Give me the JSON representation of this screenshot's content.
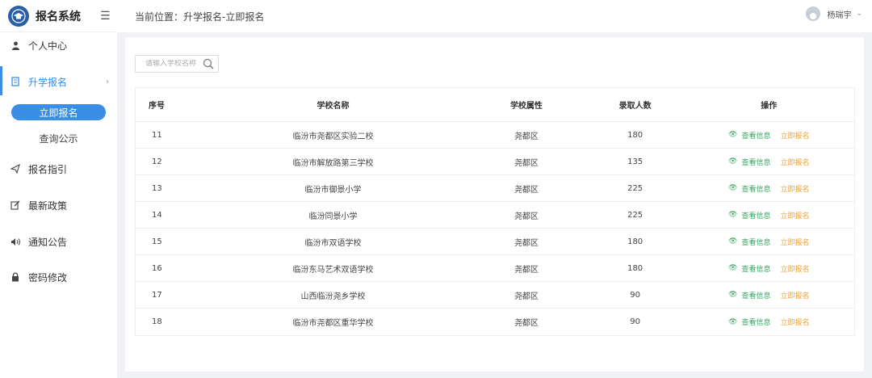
{
  "app": {
    "title": "报名系统",
    "logo_icon": "cap-logo-icon",
    "accent": "#3a8ee6"
  },
  "header": {
    "breadcrumb": "当前位置：升学报名-立即报名",
    "username": "杨瑞宇"
  },
  "sidebar": {
    "items": [
      {
        "label": "个人中心",
        "icon": "user-icon"
      },
      {
        "label": "升学报名",
        "icon": "document-icon",
        "active": true
      },
      {
        "label": "报名指引",
        "icon": "paper-plane-icon"
      },
      {
        "label": "最新政策",
        "icon": "edit-icon"
      },
      {
        "label": "通知公告",
        "icon": "speaker-icon"
      },
      {
        "label": "密码修改",
        "icon": "lock-icon"
      }
    ],
    "sub_items": [
      {
        "label": "立即报名",
        "selected": true
      },
      {
        "label": "查询公示",
        "selected": false
      }
    ]
  },
  "search": {
    "placeholder": "请输入学校名称"
  },
  "table": {
    "headers": [
      "序号",
      "学校名称",
      "学校属性",
      "录取人数",
      "操作"
    ],
    "rows": [
      {
        "no": "11",
        "name": "临汾市尧都区实验二校",
        "attr": "尧都区",
        "count": "180"
      },
      {
        "no": "12",
        "name": "临汾市解放路第三学校",
        "attr": "尧都区",
        "count": "135"
      },
      {
        "no": "13",
        "name": "临汾市御景小学",
        "attr": "尧都区",
        "count": "225"
      },
      {
        "no": "14",
        "name": "临汾同景小学",
        "attr": "尧都区",
        "count": "225"
      },
      {
        "no": "15",
        "name": "临汾市双语学校",
        "attr": "尧都区",
        "count": "180"
      },
      {
        "no": "16",
        "name": "临汾东马艺术双语学校",
        "attr": "尧都区",
        "count": "180"
      },
      {
        "no": "17",
        "name": "山西临汾尧乡学校",
        "attr": "尧都区",
        "count": "90"
      },
      {
        "no": "18",
        "name": "临汾市尧都区重华学校",
        "attr": "尧都区",
        "count": "90"
      }
    ],
    "actions": {
      "view": "查看信息",
      "apply": "立即报名"
    }
  }
}
